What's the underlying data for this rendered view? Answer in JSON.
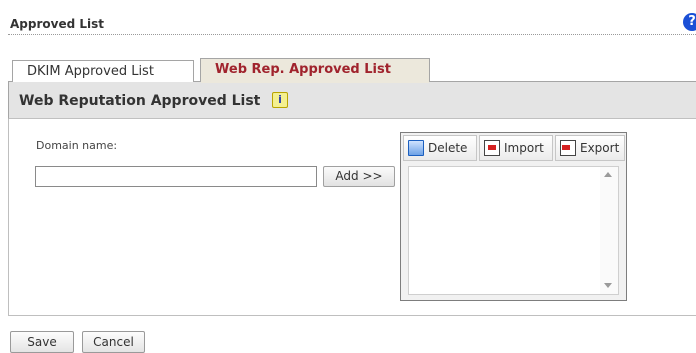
{
  "header": {
    "title": "Approved List",
    "help_icon_glyph": "?"
  },
  "tabs": [
    {
      "label": "DKIM Approved List",
      "active": false
    },
    {
      "label": "Web Rep. Approved List",
      "active": true
    }
  ],
  "section": {
    "title": "Web Reputation Approved List",
    "info_icon_glyph": "i"
  },
  "form": {
    "domain_label": "Domain name:",
    "domain_value": "",
    "domain_placeholder": "",
    "add_label": "Add >>"
  },
  "list_toolbar": {
    "delete_label": "Delete",
    "import_label": "Import",
    "export_label": "Export"
  },
  "footer": {
    "save_label": "Save",
    "cancel_label": "Cancel"
  },
  "colors": {
    "active_tab_text": "#a0232d",
    "section_bar": "#e4e4e4",
    "help_icon": "#1a4fd6"
  }
}
